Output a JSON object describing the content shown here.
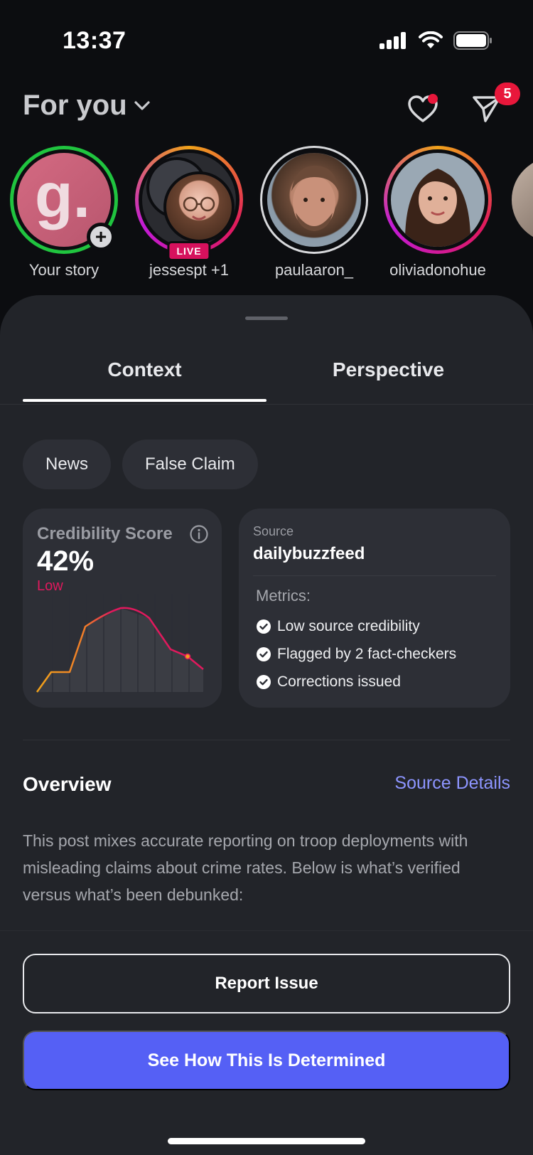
{
  "status_bar": {
    "time": "13:37",
    "icons": [
      "cellular-signal-icon",
      "wifi-icon",
      "battery-icon"
    ]
  },
  "header": {
    "title": "For you",
    "activity_icon": "heart-icon",
    "messages_icon": "send-icon",
    "messages_badge": "5"
  },
  "stories": [
    {
      "label": "Your story",
      "ring": "#20c43f",
      "type": "own"
    },
    {
      "label": "jessespt +1",
      "ring": "gradient",
      "badge": "LIVE"
    },
    {
      "label": "paulaaron_",
      "ring": "#d8d9dc"
    },
    {
      "label": "oliviadonohue",
      "ring": "gradient"
    }
  ],
  "sheet": {
    "tabs": [
      {
        "label": "Context",
        "active": true
      },
      {
        "label": "Perspective",
        "active": false
      }
    ],
    "chips": [
      "News",
      "False Claim"
    ],
    "credibility": {
      "title": "Credibility Score",
      "value": "42%",
      "level": "Low",
      "colors": {
        "low": "#e0195d",
        "mid": "#f0a21a"
      }
    },
    "source": {
      "label": "Source",
      "name": "dailybuzzfeed",
      "metrics_label": "Metrics:",
      "metrics": [
        "Low source credibility",
        "Flagged by 2 fact-checkers",
        "Corrections issued"
      ]
    },
    "overview": {
      "title": "Overview",
      "link": "Source Details",
      "text": "This post mixes accurate reporting on troop deployments with misleading claims about crime rates. Below is what’s verified versus what’s been debunked:"
    },
    "buttons": {
      "report": "Report Issue",
      "determine": "See How This Is Determined"
    }
  },
  "colors": {
    "accent": "#5560f5",
    "link": "#8d95ff",
    "danger": "#e8173b",
    "sheet_bg": "#222429"
  }
}
